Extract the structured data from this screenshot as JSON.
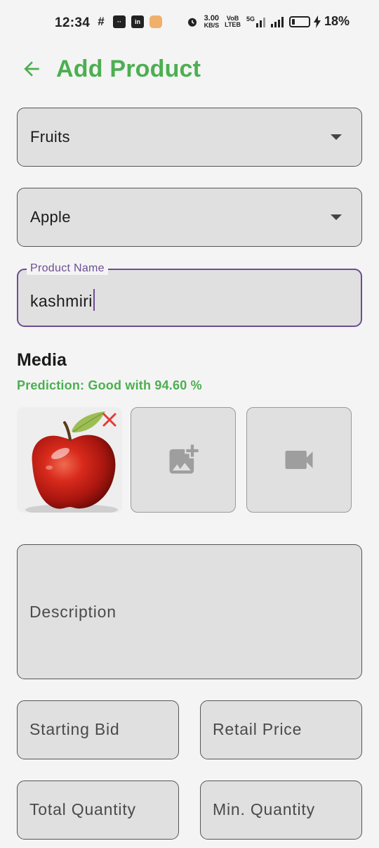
{
  "status_bar": {
    "time": "12:34",
    "net_speed_value": "3.00",
    "net_speed_unit": "KB/S",
    "volte_top": "VoB",
    "volte_bottom": "LTEB",
    "five_g": "5G",
    "battery": "18%"
  },
  "header": {
    "title": "Add Product"
  },
  "form": {
    "category": {
      "value": "Fruits"
    },
    "subcategory": {
      "value": "Apple"
    },
    "product_name": {
      "label": "Product Name",
      "value": "kashmiri"
    },
    "media": {
      "title": "Media",
      "prediction": "Prediction: Good with 94.60 %"
    },
    "description": {
      "placeholder": "Description"
    },
    "starting_bid": {
      "placeholder": "Starting Bid"
    },
    "retail_price": {
      "placeholder": "Retail Price"
    },
    "total_quantity": {
      "placeholder": "Total Quantity"
    },
    "min_quantity": {
      "placeholder": "Min. Quantity"
    }
  },
  "colors": {
    "accent_green": "#4caf50",
    "focus_purple": "#6b4e93",
    "field_bg": "#e0e0e0",
    "page_bg": "#f4f4f4",
    "remove_red": "#e53935"
  },
  "icons": [
    "back-arrow-icon",
    "dropdown-caret-icon",
    "close-icon",
    "add-photo-icon",
    "videocam-icon"
  ]
}
